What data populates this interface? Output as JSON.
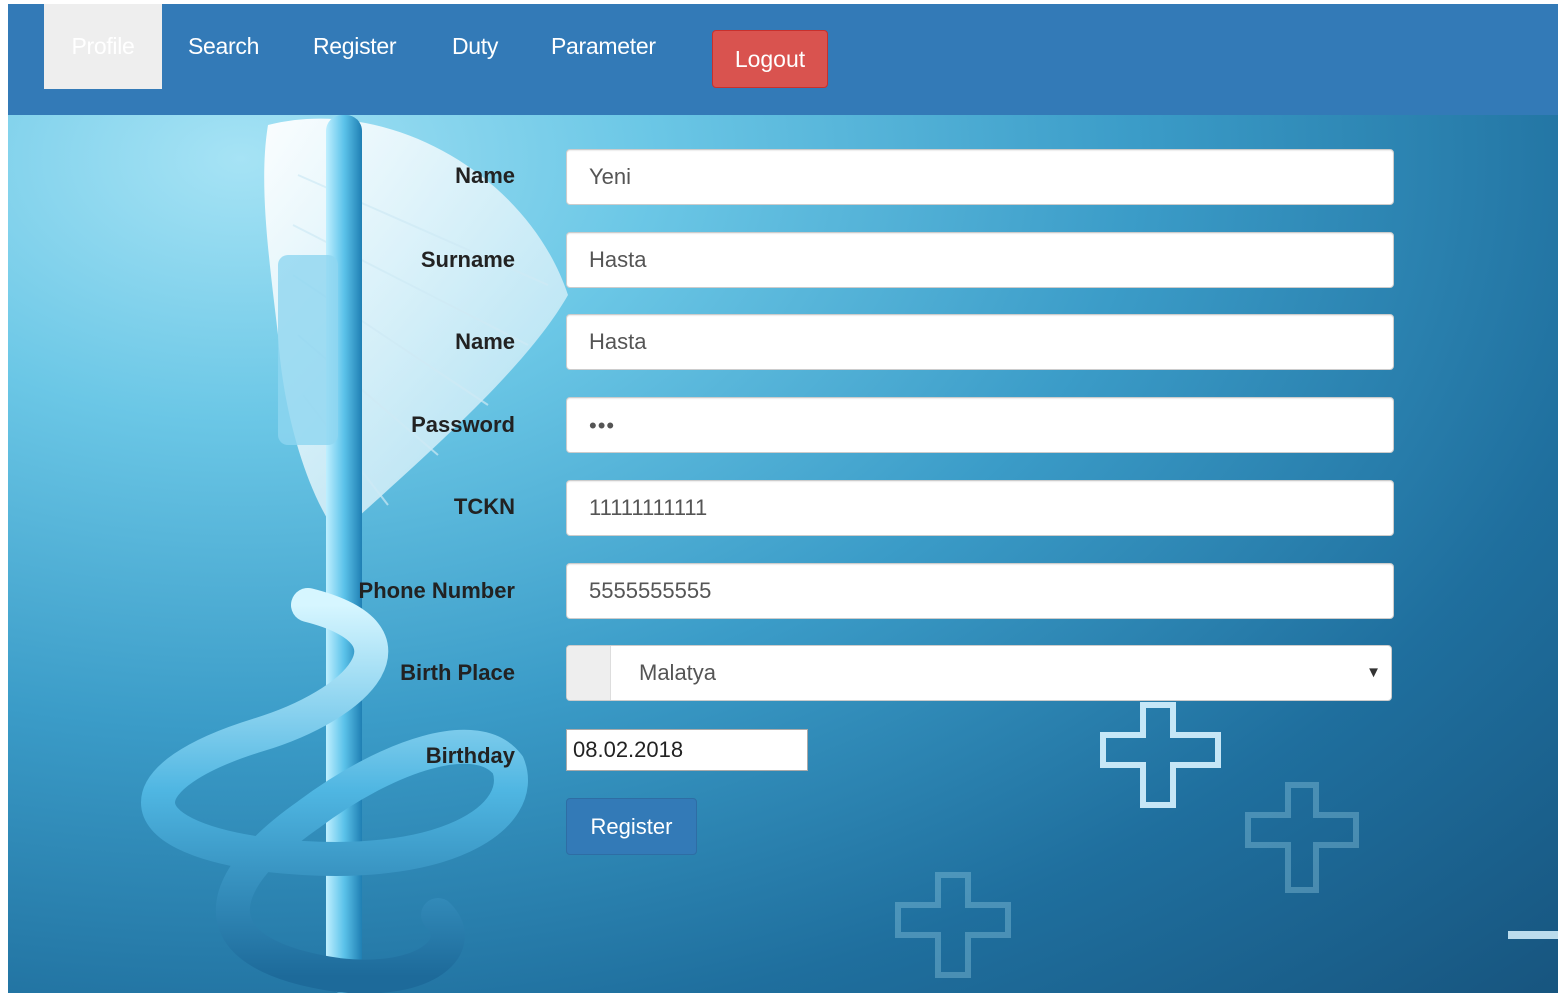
{
  "nav": {
    "items": [
      {
        "label": "Profile",
        "active": true
      },
      {
        "label": "Search"
      },
      {
        "label": "Register"
      },
      {
        "label": "Duty"
      },
      {
        "label": "Parameter"
      }
    ],
    "logout_label": "Logout"
  },
  "form": {
    "fields": [
      {
        "label": "Name",
        "value": "Yeni"
      },
      {
        "label": "Surname",
        "value": "Hasta"
      },
      {
        "label": "Name",
        "value": "Hasta"
      },
      {
        "label": "Password",
        "value": "•••"
      },
      {
        "label": "TCKN",
        "value": "11111111111"
      },
      {
        "label": "Phone Number",
        "value": "5555555555"
      }
    ],
    "birth_place": {
      "label": "Birth Place",
      "value": "Malatya",
      "caret": "▼"
    },
    "birthday": {
      "label": "Birthday",
      "value": "08.02.2018"
    },
    "submit_label": "Register"
  },
  "colors": {
    "navbar": "#337ab7",
    "logout": "#d9534f",
    "primary_button": "#337ab7",
    "active_nav": "#eeeeee"
  }
}
